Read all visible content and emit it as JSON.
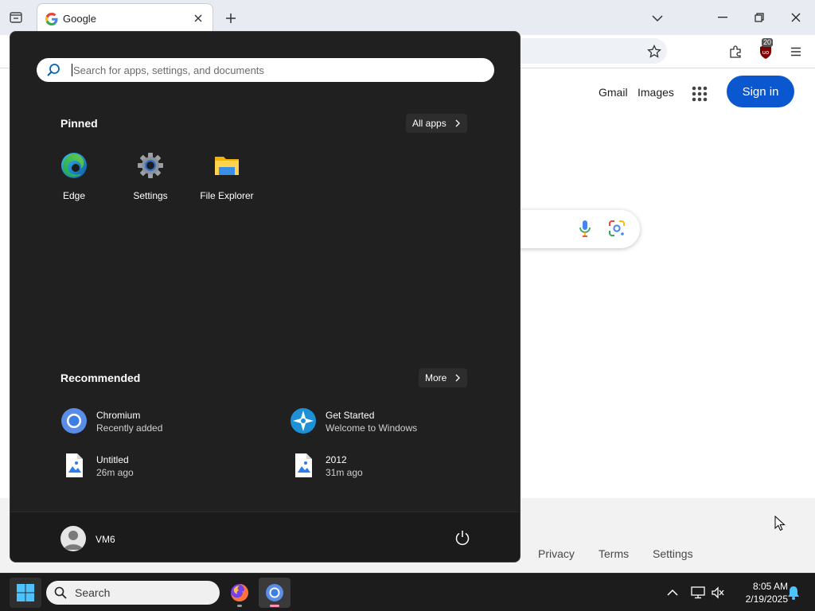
{
  "browser": {
    "tab_title": "Google",
    "ublock_count": "20"
  },
  "google": {
    "header_links": [
      "Gmail",
      "Images"
    ],
    "sign_in": "Sign in",
    "footer_links": [
      "Privacy",
      "Terms",
      "Settings"
    ]
  },
  "start_menu": {
    "search_placeholder": "Search for apps, settings, and documents",
    "pinned_heading": "Pinned",
    "all_apps_label": "All apps",
    "pinned": [
      {
        "label": "Edge",
        "icon": "edge-icon"
      },
      {
        "label": "Settings",
        "icon": "settings-gear-icon"
      },
      {
        "label": "File Explorer",
        "icon": "folder-icon"
      }
    ],
    "recommended_heading": "Recommended",
    "more_label": "More",
    "recommended": [
      {
        "name": "Chromium",
        "sub": "Recently added",
        "icon": "chromium-icon"
      },
      {
        "name": "Get Started",
        "sub": "Welcome to Windows",
        "icon": "get-started-icon"
      },
      {
        "name": "Untitled",
        "sub": "26m ago",
        "icon": "image-file-icon"
      },
      {
        "name": "2012",
        "sub": "31m ago",
        "icon": "image-file-icon"
      }
    ],
    "user_name": "VM6"
  },
  "taskbar": {
    "search_label": "Search",
    "time": "8:05 AM",
    "date": "2/19/2025"
  },
  "colors": {
    "start_bg": "#202020",
    "google_blue": "#0b57d0",
    "taskbar_bg": "#1c1c1c"
  }
}
